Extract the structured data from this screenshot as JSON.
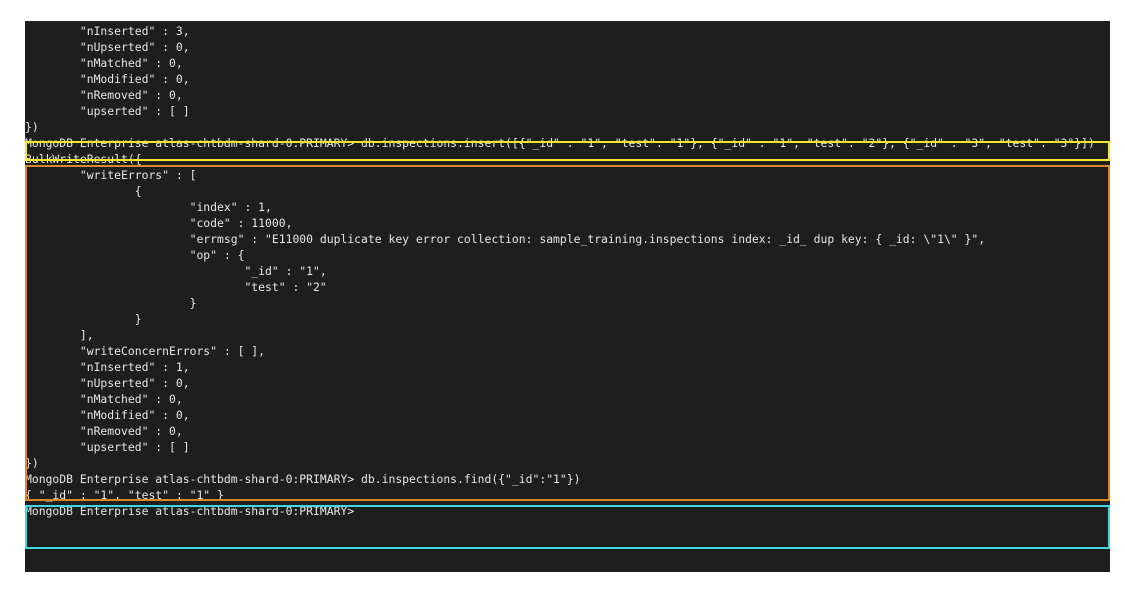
{
  "terminal": {
    "lines": [
      "        \"nInserted\" : 3,",
      "        \"nUpserted\" : 0,",
      "        \"nMatched\" : 0,",
      "        \"nModified\" : 0,",
      "        \"nRemoved\" : 0,",
      "        \"upserted\" : [ ]",
      "})",
      "MongoDB Enterprise atlas-chtbdm-shard-0:PRIMARY> db.inspections.insert([{\"_id\" : \"1\", \"test\": \"1\"}, {\"_id\" : \"1\", \"test\": \"2\"}, {\"_id\" : \"3\", \"test\": \"3\"}])",
      "BulkWriteResult({",
      "        \"writeErrors\" : [",
      "                {",
      "                        \"index\" : 1,",
      "                        \"code\" : 11000,",
      "                        \"errmsg\" : \"E11000 duplicate key error collection: sample_training.inspections index: _id_ dup key: { _id: \\\"1\\\" }\",",
      "                        \"op\" : {",
      "                                \"_id\" : \"1\",",
      "                                \"test\" : \"2\"",
      "                        }",
      "                }",
      "        ],",
      "        \"writeConcernErrors\" : [ ],",
      "        \"nInserted\" : 1,",
      "        \"nUpserted\" : 0,",
      "        \"nMatched\" : 0,",
      "        \"nModified\" : 0,",
      "        \"nRemoved\" : 0,",
      "        \"upserted\" : [ ]",
      "})",
      "MongoDB Enterprise atlas-chtbdm-shard-0:PRIMARY> db.inspections.find({\"_id\":\"1\"})",
      "{ \"_id\" : \"1\", \"test\" : \"1\" }",
      "MongoDB Enterprise atlas-chtbdm-shard-0:PRIMARY>"
    ]
  },
  "highlight_colors": {
    "command": "#f5e829",
    "output": "#e0862a",
    "find": "#3fd6e6"
  }
}
